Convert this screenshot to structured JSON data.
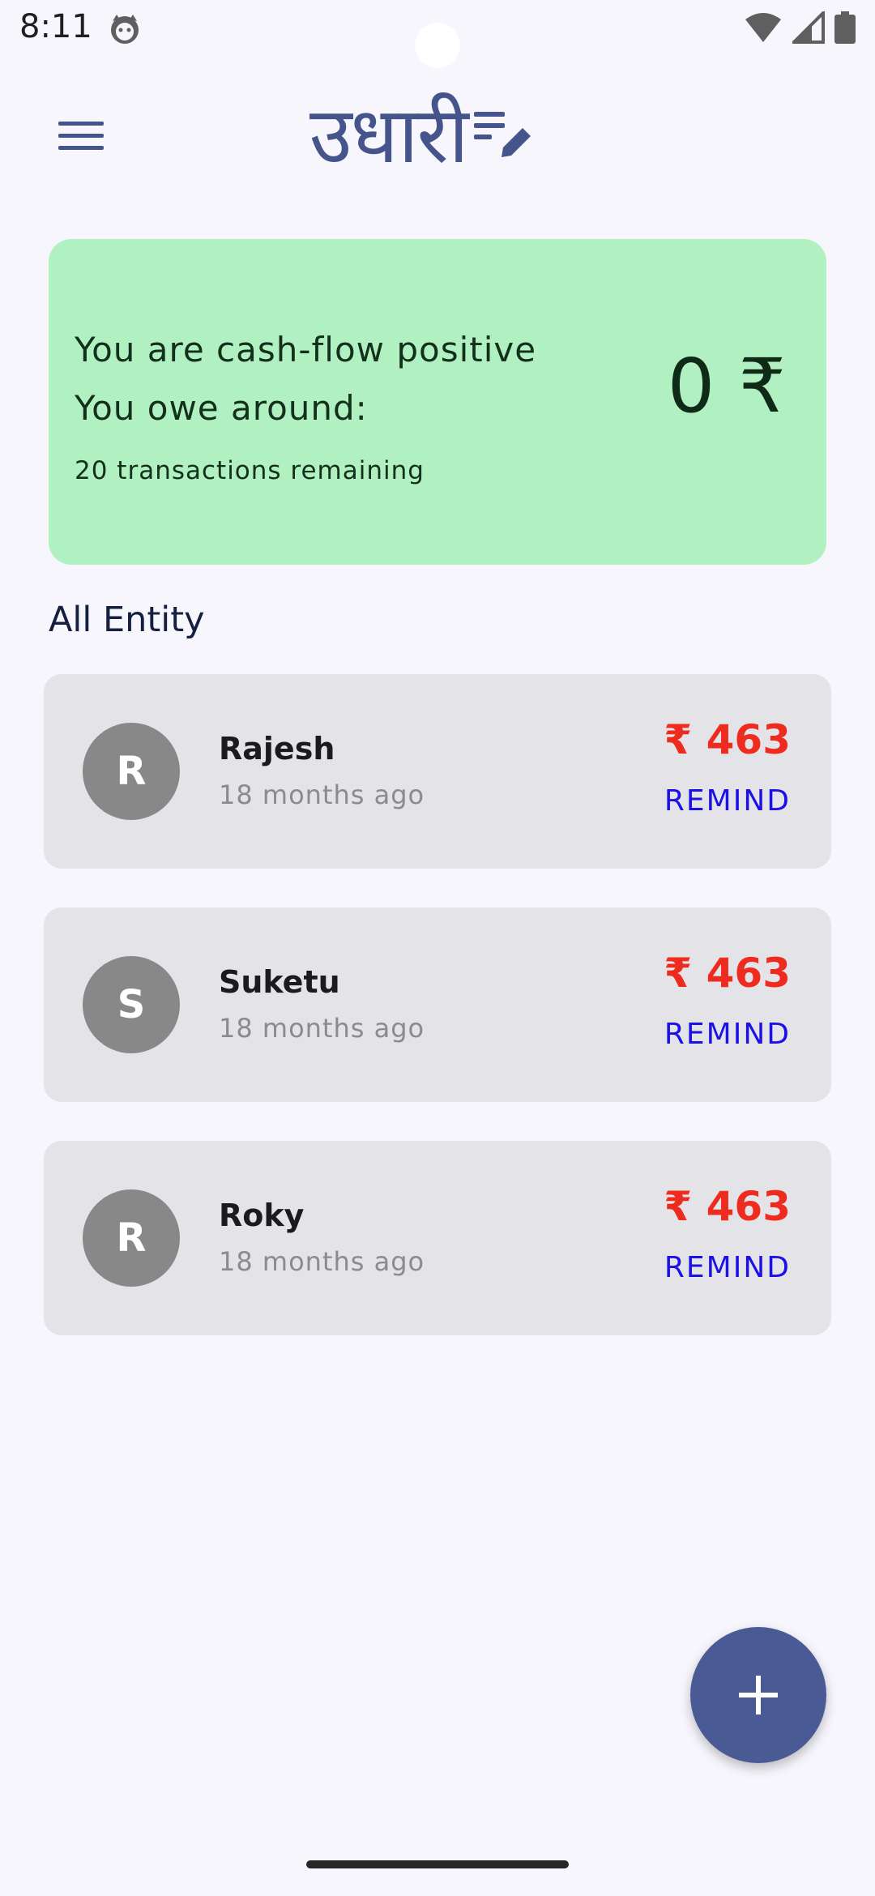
{
  "status_bar": {
    "time": "8:11",
    "icons": [
      "cat-notification-icon",
      "wifi-icon",
      "cellular-signal-icon",
      "battery-icon"
    ]
  },
  "app_bar": {
    "menu_icon": "hamburger-menu-icon",
    "logo_text": "उधारी",
    "logo_icon": "edit-list-icon",
    "accent_color": "#46548c"
  },
  "summary": {
    "line1": "You are cash-flow positive",
    "line2": "You owe around:",
    "line3": "20 transactions remaining",
    "amount": "0 ₹",
    "background_color": "#b1f1c1"
  },
  "section": {
    "title": "All Entity"
  },
  "entities": [
    {
      "initial": "R",
      "name": "Rajesh",
      "time": "18 months ago",
      "amount": "₹ 463",
      "action": "REMIND"
    },
    {
      "initial": "S",
      "name": "Suketu",
      "time": "18 months ago",
      "amount": "₹ 463",
      "action": "REMIND"
    },
    {
      "initial": "R",
      "name": "Roky",
      "time": "18 months ago",
      "amount": "₹ 463",
      "action": "REMIND"
    }
  ],
  "fab": {
    "icon": "plus-icon",
    "color": "#4a5a94"
  },
  "colors": {
    "amount": "#ee2b1f",
    "remind": "#1b10e6"
  }
}
